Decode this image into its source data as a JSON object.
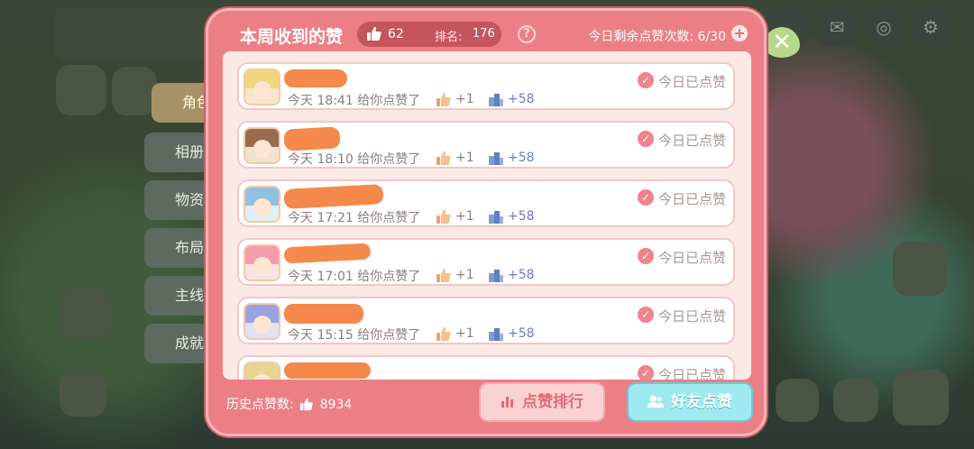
{
  "dialog": {
    "title": "本周收到的赞",
    "weekly_likes": "62",
    "rank_label": "排名:",
    "rank_value": "176",
    "remaining": "今日剩余点赞次数: 6/30"
  },
  "likes": [
    {
      "time": "今天 18:41 给你点赞了",
      "plus": "+1",
      "reward": "+58",
      "status": "今日已点赞"
    },
    {
      "time": "今天 18:10 给你点赞了",
      "plus": "+1",
      "reward": "+58",
      "status": "今日已点赞"
    },
    {
      "time": "今天 17:21 给你点赞了",
      "plus": "+1",
      "reward": "+58",
      "status": "今日已点赞"
    },
    {
      "time": "今天 17:01 给你点赞了",
      "plus": "+1",
      "reward": "+58",
      "status": "今日已点赞"
    },
    {
      "time": "今天 15:15 给你点赞了",
      "plus": "+1",
      "reward": "+58",
      "status": "今日已点赞"
    },
    {
      "time": "",
      "plus": "",
      "reward": "",
      "status": "今日已点赞"
    }
  ],
  "footer": {
    "history_label": "历史点赞数:",
    "history_value": "8934",
    "rank_button": "点赞排行",
    "friends_button": "好友点赞"
  },
  "side_menu": [
    "角色",
    "相册",
    "物资",
    "布局",
    "主线",
    "成就"
  ],
  "icons": [
    "thumbs-up-icon",
    "help-icon",
    "plus-icon",
    "close-icon",
    "check-icon",
    "building-icon",
    "ranking-icon",
    "friends-icon"
  ],
  "colors": {
    "dialog": "#ec7f86",
    "panel": "#fbe9e6",
    "accent_pink": "#f0838c",
    "reward_blue": "#6f78c8",
    "friends_button": "#9eeaf0"
  }
}
